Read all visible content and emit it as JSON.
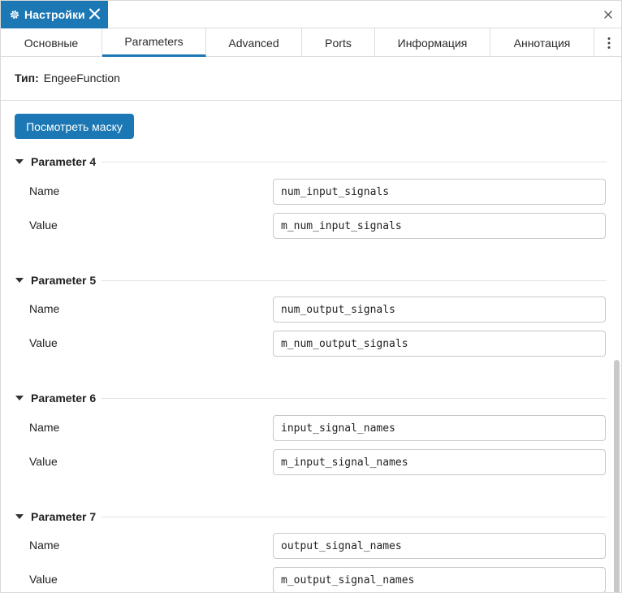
{
  "window": {
    "title": "Настройки",
    "icons": {
      "settings": "gear-icon",
      "tab_close": "close-icon",
      "window_close": "close-icon",
      "more": "vertical-dots-icon"
    },
    "accent_color": "#1b78b4"
  },
  "tabs": [
    {
      "label": "Основные",
      "active": false
    },
    {
      "label": "Parameters",
      "active": true
    },
    {
      "label": "Advanced",
      "active": false
    },
    {
      "label": "Ports",
      "active": false
    },
    {
      "label": "Информация",
      "active": false
    },
    {
      "label": "Аннотация",
      "active": false
    }
  ],
  "type": {
    "label": "Тип:",
    "value": "EngeeFunction"
  },
  "mask_button": "Посмотреть маску",
  "groups": [
    {
      "title": "Parameter 4",
      "name_label": "Name",
      "name_value": "num_input_signals",
      "value_label": "Value",
      "value_value": "m_num_input_signals"
    },
    {
      "title": "Parameter 5",
      "name_label": "Name",
      "name_value": "num_output_signals",
      "value_label": "Value",
      "value_value": "m_num_output_signals"
    },
    {
      "title": "Parameter 6",
      "name_label": "Name",
      "name_value": "input_signal_names",
      "value_label": "Value",
      "value_value": "m_input_signal_names"
    },
    {
      "title": "Parameter 7",
      "name_label": "Name",
      "name_value": "output_signal_names",
      "value_label": "Value",
      "value_value": "m_output_signal_names"
    }
  ]
}
